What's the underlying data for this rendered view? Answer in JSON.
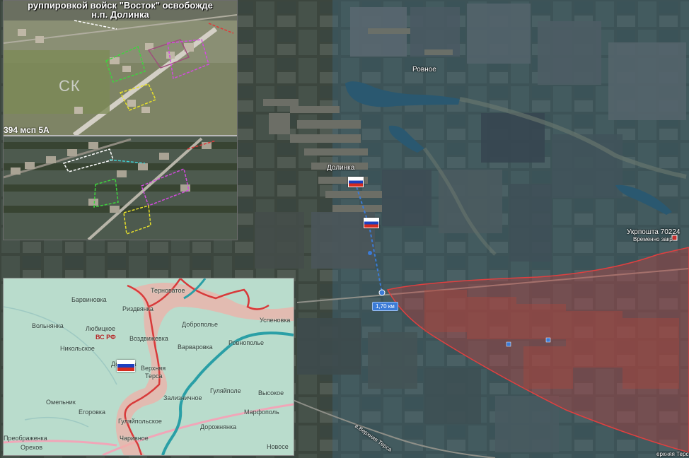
{
  "main_map": {
    "labels": {
      "rovnoe": "Ровное",
      "dolinka": "Долинка",
      "ukrposhta": "Укрпошта 70224",
      "temporarily_closed": "Временно закр",
      "lower_road": "в.Верхняя Терса",
      "bottom_right": "ерхняя Терса"
    },
    "distance_label": "1,70 км",
    "colors": {
      "occupied_zone": "#d23a3a",
      "measure_line": "#3b7bd6",
      "flag_blue": "#1c3fbf",
      "flag_red": "#d52b1e"
    }
  },
  "drone_inset": {
    "headline_1": "руппировкой войск \"Восток\" освобожде",
    "headline_2": "н.п. Долинка",
    "unit_label": "394 мсп 5А",
    "marking": "СК"
  },
  "front_map": {
    "towns": {
      "ternovatoe": "Терноватое",
      "barvinovka": "Барвиновка",
      "rizdvyanka": "Риздвянка",
      "volnyanka": "Вольнянка",
      "lyubitskoe": "Любицкое",
      "vs_rf": "ВС РФ",
      "vozdvizhevka": "Воздвижевка",
      "dobropolie": "Доброполье",
      "uspenovka": "Успеновка",
      "nikolskoe": "Никольское",
      "varvarovka": "Варваровка",
      "rovnopolie": "Ровнополье",
      "dolinka": "Долинка",
      "verkhnyaya_tersa_1": "Верхняя",
      "verkhnyaya_tersa_2": "Терса",
      "zaliznichnoe": "Зализничное",
      "gulyaipole": "Гуляйполе",
      "vysokoe": "Высокое",
      "omelnik": "Омельник",
      "egorovka": "Егоровка",
      "marfopol": "Марфополь",
      "gulyaipolskoe": "Гуляйпольское",
      "preobrazhenka": "Преображенка",
      "charivnoe": "Чаривное",
      "dorozhnyanka": "Дорожнянка",
      "novoselovka": "Новосе",
      "orekhov": "Орехов"
    },
    "colors": {
      "frontline": "#d83a3a",
      "frontline_buffer": "#f0b0a8",
      "river": "#2a9fa6",
      "water_bg": "#b9dccc"
    }
  }
}
